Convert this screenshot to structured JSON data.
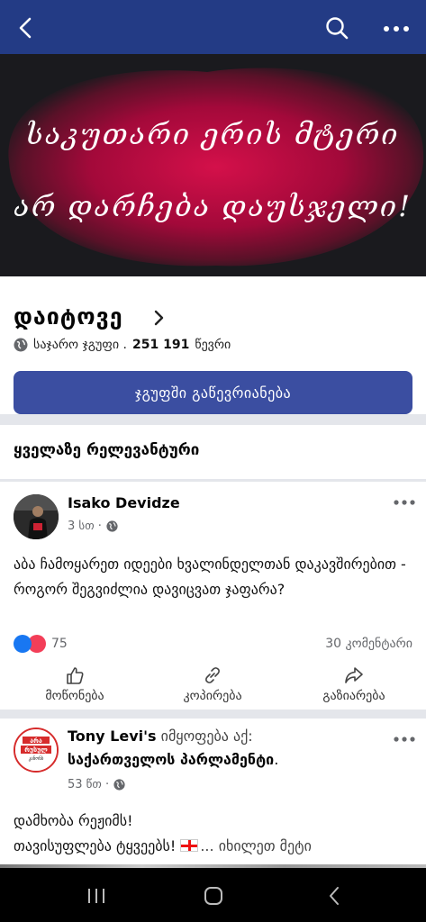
{
  "topbar": {
    "back_icon": "back-arrow-icon",
    "search_icon": "search-icon",
    "more_icon": "more-dots-icon",
    "bg_color": "#233b85"
  },
  "cover": {
    "line1": "საკუთარი ერის მტერი",
    "line2": "არ დარჩება დაუსჯელი!"
  },
  "group": {
    "name": "დაიტოვე",
    "privacy": "საჯარო ჯგუფი .",
    "members_count": "251 191",
    "members_label": "წევრი",
    "join_label": "ჯგუფში გაწევრიანება",
    "join_color": "#3b4ea1"
  },
  "feed": {
    "sort_label": "ყველაზე რელევანტური"
  },
  "posts": [
    {
      "author": "Isako Devidze",
      "time": "3 სთ ·",
      "text": "აბა ჩამოყარეთ იდეები ხვალინდელთან დაკავშირებით - როგორ შეგვიძლია დავიცვათ ჯაფარა?",
      "reactions_count": "75",
      "comments": "30 კომენტარი",
      "actions": {
        "like": "მოწონება",
        "copy": "კოპირება",
        "share": "გაზიარება"
      }
    },
    {
      "author": "Tony Levi's",
      "status": "იმყოფება აქ:",
      "place": "საქართველოს პარლამენტი",
      "place_suffix": ".",
      "time": "53 წთ ·",
      "text_line1": "დამხობა რეჟიმს!",
      "text_line2": "თავისუფლება ტყვეებს!",
      "see_more": "... იხილეთ მეტი",
      "avatar_text_top": "არა",
      "avatar_text_mid": "რუსულ",
      "avatar_text_bot": "კანონს"
    }
  ]
}
